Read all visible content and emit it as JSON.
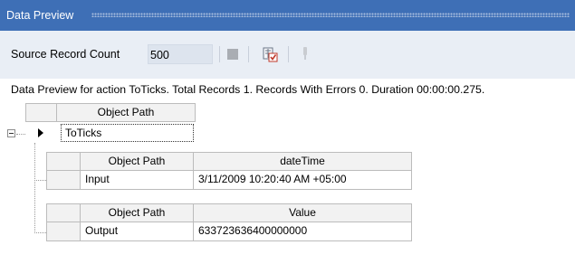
{
  "window": {
    "title": "Data Preview"
  },
  "toolbar": {
    "source_count_label": "Source Record Count",
    "source_count_value": "500"
  },
  "status": {
    "message": "Data Preview for action ToTicks. Total Records 1. Records With Errors 0. Duration 00:00:00.275."
  },
  "grid": {
    "root": {
      "header": "Object Path",
      "row_value": "ToTicks"
    },
    "input_table": {
      "headers": [
        "Object Path",
        "dateTime"
      ],
      "row": [
        "Input",
        "3/11/2009 10:20:40 AM +05:00"
      ]
    },
    "output_table": {
      "headers": [
        "Object Path",
        "Value"
      ],
      "row": [
        "Output",
        "633723636400000000"
      ]
    }
  }
}
